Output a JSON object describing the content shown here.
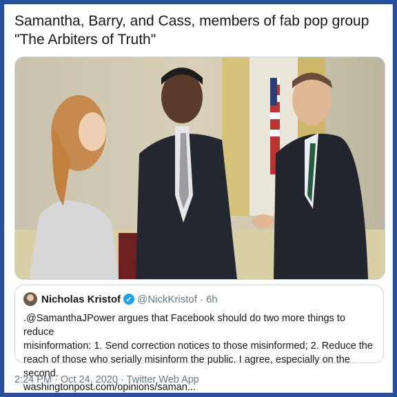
{
  "tweet": {
    "text": "Samantha, Barry, and Cass, members of fab pop group\n\"The Arbiters of Truth\"",
    "image_alt": "photo of three people talking in an office with a flag"
  },
  "quote": {
    "name": "Nicholas Kristof",
    "verified_icon": "verified-badge-icon",
    "handle": "@NickKristof",
    "separator": "·",
    "time": "6h",
    "body": ".@SamanthaJPower argues that Facebook should do two more things to reduce\nmisinformation: 1. Send correction notices to those misinformed; 2. Reduce the\nreach of those who serially misinform the public. I agree, especially on the second.\nwashingtonpost.com/opinions/saman..."
  },
  "footer": {
    "meta": "2:24 PM · Oct 24, 2020 · Twitter Web App"
  },
  "colors": {
    "frame": "#2a4f9c",
    "verified": "#1da1f2",
    "muted": "#657786"
  }
}
